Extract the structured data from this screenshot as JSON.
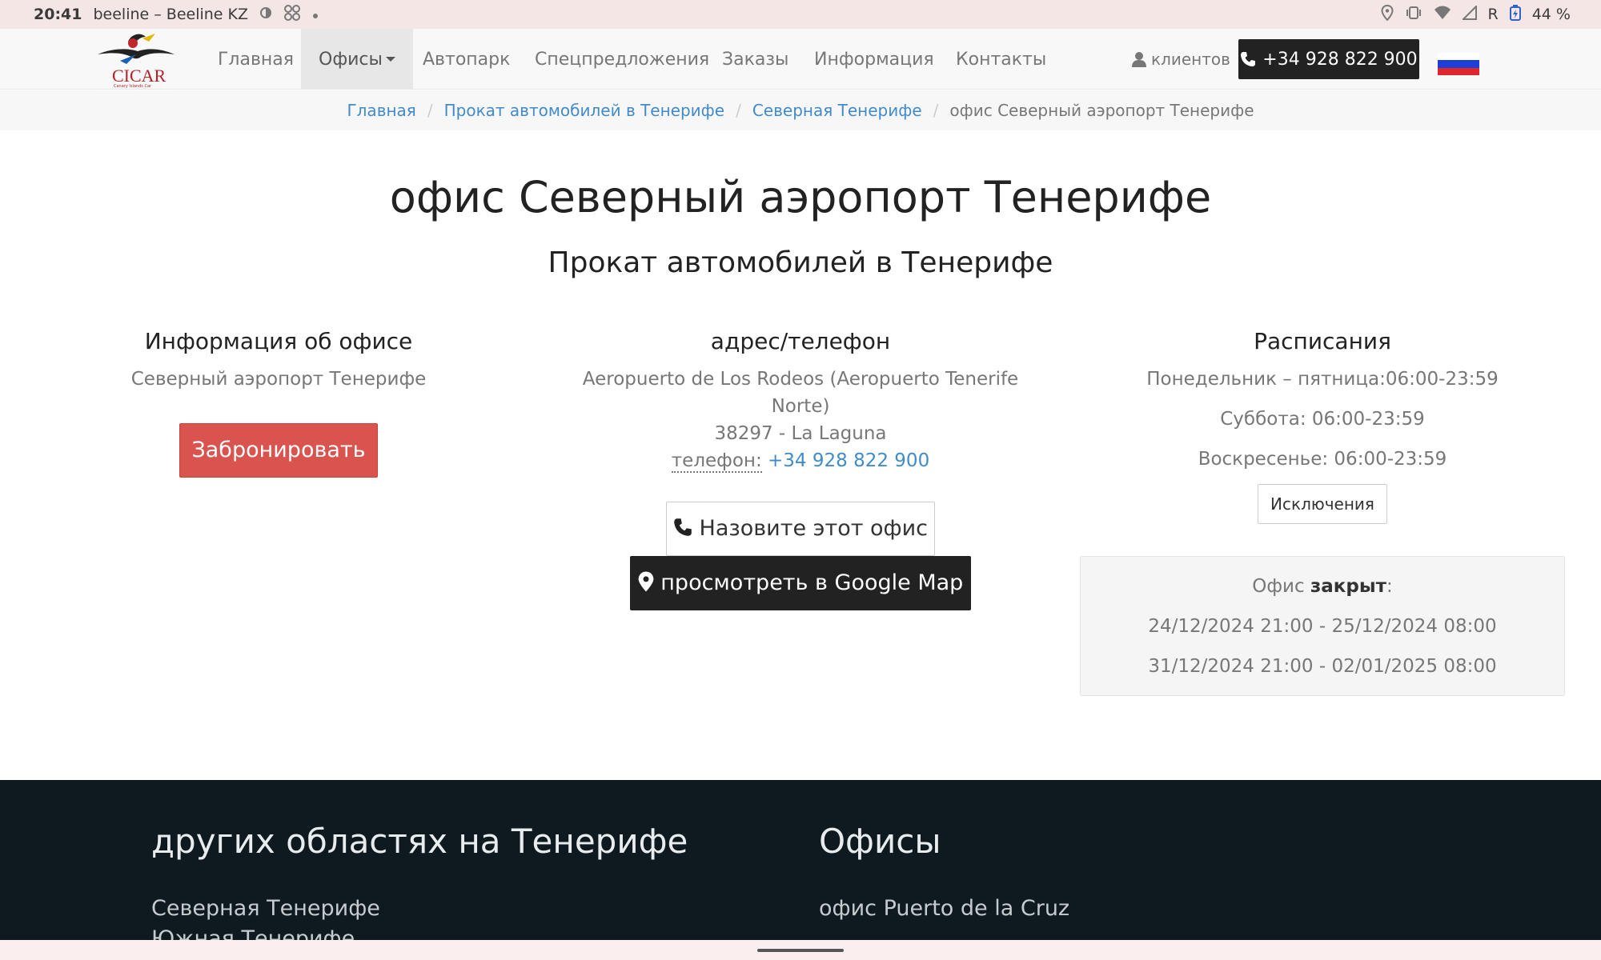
{
  "status_bar": {
    "time": "20:41",
    "carrier": "beeline – Beeline KZ",
    "roaming": "R",
    "battery": "44 %"
  },
  "nav": {
    "logo_text": "CICAR",
    "logo_sub": "Canary Islands Car",
    "items": [
      {
        "label": "Главная"
      },
      {
        "label": "Офисы"
      },
      {
        "label": "Автопарк"
      },
      {
        "label": "Спецпредложения"
      },
      {
        "label": "Заказы"
      },
      {
        "label": "Информация"
      },
      {
        "label": "Контакты"
      }
    ],
    "clients_label": "клиентов",
    "phone": "+34 928 822 900",
    "flag_colors": [
      "#ffffff",
      "#1c3fd8",
      "#e0262d"
    ]
  },
  "breadcrumb": {
    "items": [
      {
        "label": "Главная"
      },
      {
        "label": "Прокат автомобилей в Тенерифе"
      },
      {
        "label": "Северная Тенерифе"
      }
    ],
    "current": "офис Северный аэропорт Тенерифе"
  },
  "page": {
    "title": "офис Северный аэропорт Тенерифе",
    "subtitle": "Прокат автомобилей в Тенерифе"
  },
  "office_info": {
    "title": "Информация об офисе",
    "name": "Северный аэропорт Тенерифе",
    "book_label": "Забронировать"
  },
  "address": {
    "title": "адрес/телефон",
    "line1": "Aeropuerto de Los Rodeos (Aeropuerto Tenerife Norte)",
    "line2": "38297 - La Laguna",
    "phone_label": "телефон:",
    "phone": "+34 928 822 900",
    "call_label": "Назовите этот офис",
    "map_label": "просмотреть в Google Map"
  },
  "schedule": {
    "title": "Расписания",
    "lines": [
      "Понедельник – пятница:06:00-23:59",
      "Суббота: 06:00-23:59",
      "Воскресенье: 06:00-23:59"
    ],
    "exceptions_label": "Исключения",
    "closed_prefix": "Офис",
    "closed_word": "закрыт",
    "closed_suffix": ":",
    "closed_periods": [
      "24/12/2024 21:00 - 25/12/2024 08:00",
      "31/12/2024 21:00 - 02/01/2025 08:00"
    ]
  },
  "footer": {
    "areas_title": "других областях на Тенерифе",
    "areas": [
      "Северная Тенерифе",
      "Южная Тенерифе"
    ],
    "offices_title": "Офисы",
    "offices": [
      "офис Puerto de la Cruz"
    ]
  }
}
